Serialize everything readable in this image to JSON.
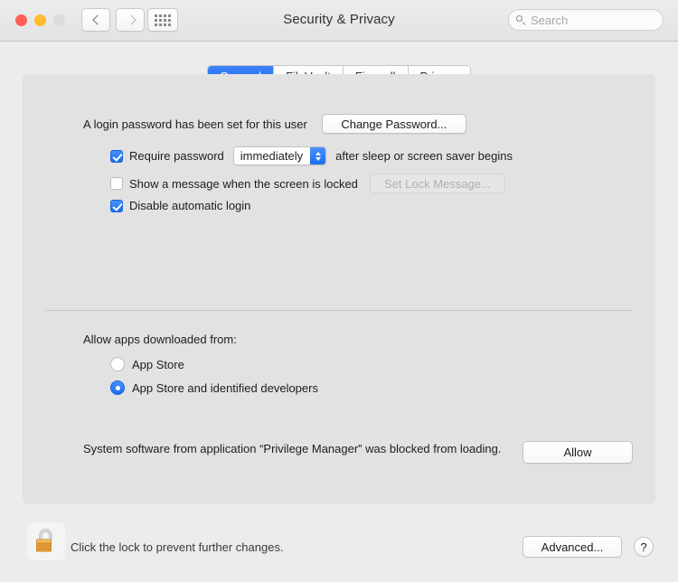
{
  "window": {
    "title": "Security & Privacy",
    "traffic_lights": [
      "close",
      "minimize",
      "zoom"
    ],
    "back_label": "Back",
    "forward_label": "Forward",
    "show_all_label": "Show All"
  },
  "search": {
    "placeholder": "Search",
    "value": ""
  },
  "tabs": [
    {
      "label": "General",
      "active": true
    },
    {
      "label": "FileVault",
      "active": false
    },
    {
      "label": "Firewall",
      "active": false
    },
    {
      "label": "Privacy",
      "active": false
    }
  ],
  "login": {
    "status_text": "A login password has been set for this user",
    "change_password_label": "Change Password...",
    "require_password": {
      "checked": true,
      "label_before": "Require password",
      "value": "immediately",
      "label_after": "after sleep or screen saver begins"
    },
    "lock_message": {
      "checked": false,
      "label": "Show a message when the screen is locked",
      "button_label": "Set Lock Message...",
      "button_disabled": true
    },
    "disable_auto_login": {
      "checked": true,
      "label": "Disable automatic login"
    }
  },
  "gatekeeper": {
    "heading": "Allow apps downloaded from:",
    "options": [
      {
        "label": "App Store",
        "selected": false
      },
      {
        "label": "App Store and identified developers",
        "selected": true
      }
    ]
  },
  "blocked": {
    "message": "System software from application “Privilege Manager” was blocked from loading.",
    "allow_label": "Allow"
  },
  "footer": {
    "lock_icon": "unlocked-padlock-icon",
    "lock_text": "Click the lock to prevent further changes.",
    "advanced_label": "Advanced...",
    "help_label": "?"
  },
  "colors": {
    "accent": "#1a6ff0",
    "window_bg": "#ececec",
    "panel_bg": "#e2e2e2"
  }
}
